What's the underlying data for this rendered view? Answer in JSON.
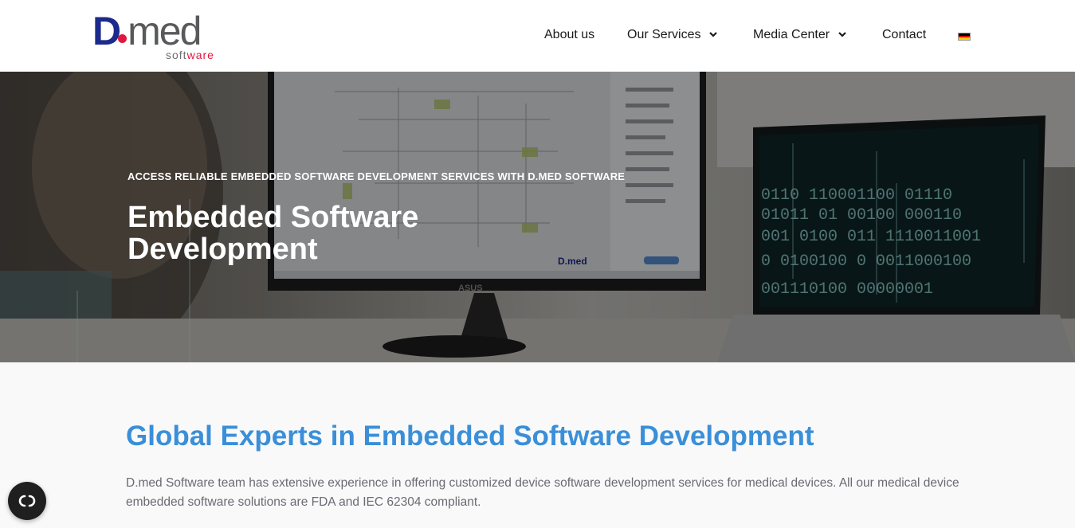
{
  "logo": {
    "brand_main": "med",
    "brand_initial": "D",
    "brand_sub_prefix": "soft",
    "brand_sub_accent": "ware"
  },
  "nav": {
    "items": [
      {
        "label": "About us",
        "has_dropdown": false
      },
      {
        "label": "Our Services",
        "has_dropdown": true
      },
      {
        "label": "Media Center",
        "has_dropdown": true
      },
      {
        "label": "Contact",
        "has_dropdown": false
      }
    ],
    "language_flag": "german-flag-icon",
    "flag_colors": [
      "#000000",
      "#dd0000",
      "#ffce00"
    ]
  },
  "hero": {
    "kicker": "ACCESS RELIABLE EMBEDDED SOFTWARE DEVELOPMENT SERVICES WITH D.MED SOFTWARE",
    "title": "Embedded Software Development",
    "monitor_brand": "ASUS",
    "screen_logo": "D.med"
  },
  "main": {
    "heading": "Global Experts in Embedded Software Development",
    "body": "D.med Software team has extensive experience in offering customized device software development services for medical devices. All our medical device embedded software solutions are FDA and IEC 62304 compliant."
  },
  "colors": {
    "brand_blue": "#1b2a8c",
    "brand_red": "#e3173e",
    "heading_blue": "#3a8fd9"
  },
  "cookie_button": {
    "icon": "cookie-consent-icon"
  }
}
